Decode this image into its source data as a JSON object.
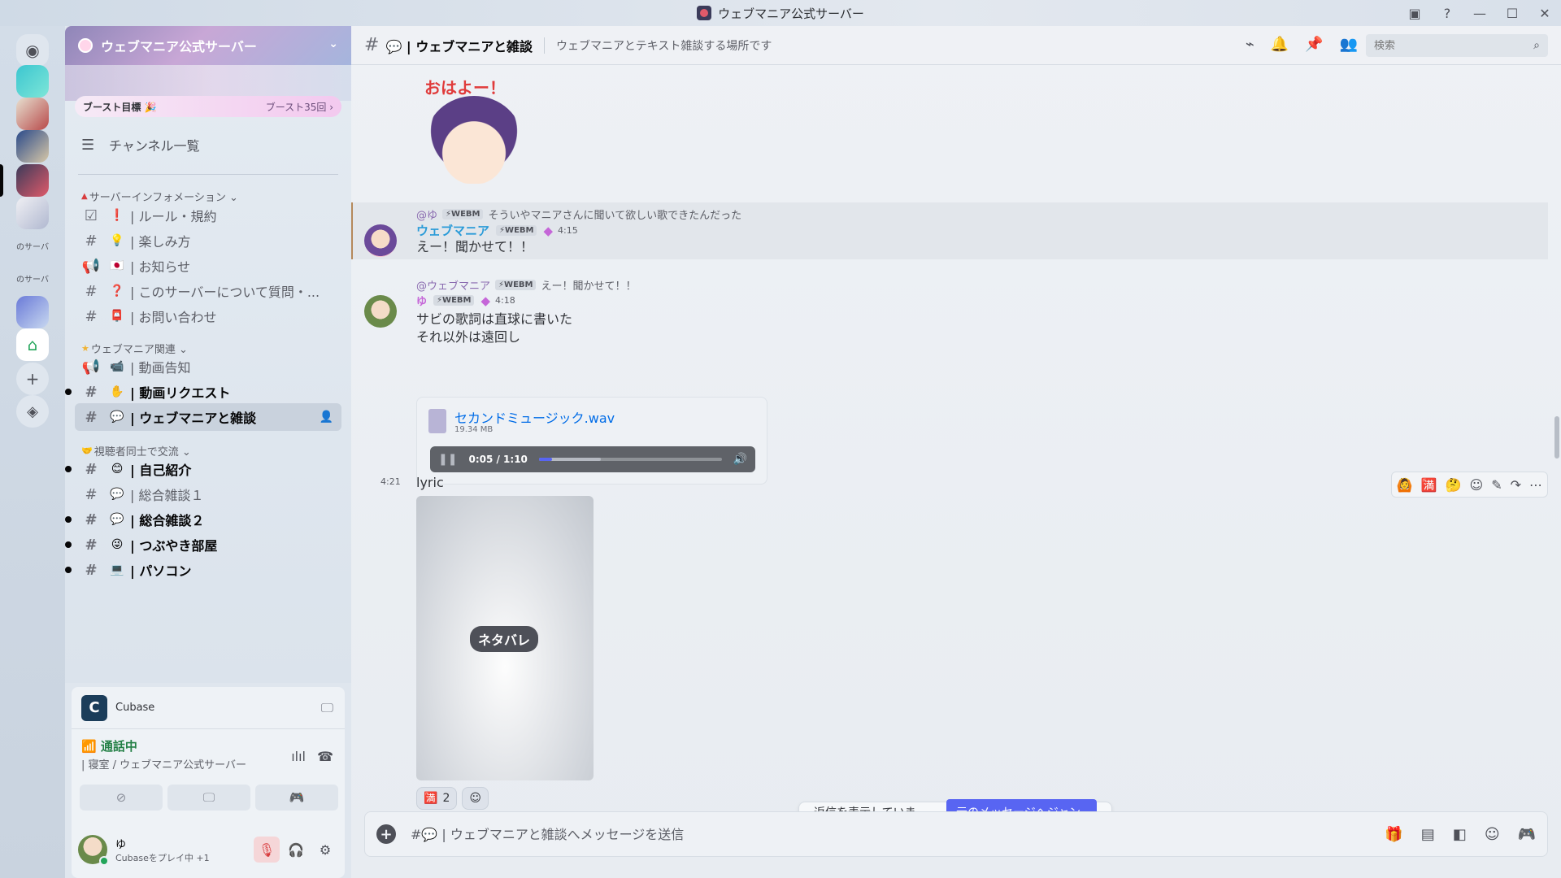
{
  "window": {
    "title": "ウェブマニア公式サーバー"
  },
  "rail": {
    "labels": [
      "のサーバ",
      "のサーバ"
    ]
  },
  "guild": {
    "name": "ウェブマニア公式サーバー",
    "boost_goal": "ブースト目標 🎉",
    "boost_count": "ブースト35回 ›",
    "channel_browser": "チャンネル一覧"
  },
  "categories": [
    {
      "label": "サーバーインフォメーション ⌄"
    },
    {
      "label": "ウェブマニア関連 ⌄"
    },
    {
      "label": "視聴者同士で交流 ⌄"
    }
  ],
  "channels": [
    {
      "emoji": "❗",
      "label": "| ルール・規約"
    },
    {
      "emoji": "💡",
      "label": "| 楽しみ方"
    },
    {
      "emoji": "🇯🇵",
      "label": "| お知らせ"
    },
    {
      "emoji": "❓",
      "label": "| このサーバーについて質問・..."
    },
    {
      "emoji": "📮",
      "label": "| お問い合わせ"
    },
    {
      "emoji": "📹",
      "label": "| 動画告知"
    },
    {
      "emoji": "✋",
      "label": "| 動画リクエスト"
    },
    {
      "emoji": "💬",
      "label": "| ウェブマニアと雑談"
    },
    {
      "emoji": "😊",
      "label": "| 自己紹介"
    },
    {
      "emoji": "💬",
      "label": "| 総合雑談１"
    },
    {
      "emoji": "💬",
      "label": "| 総合雑談２"
    },
    {
      "emoji": "😜",
      "label": "| つぶやき部屋"
    },
    {
      "emoji": "💻",
      "label": "| パソコン"
    }
  ],
  "activity": {
    "app": "Cubase"
  },
  "voice": {
    "status": "通話中",
    "channel": "| 寝室 / ウェブマニア公式サーバー"
  },
  "user": {
    "name": "ゆ",
    "status": "Cubaseをプレイ中 +1"
  },
  "topbar": {
    "channel": "💬 | ウェブマニアと雑談",
    "topic": "ウェブマニアとテキスト雑談する場所です",
    "search_placeholder": "検索"
  },
  "chat": {
    "sticker_text": "おはよー！",
    "msg1": {
      "reply_author": "@ゆ",
      "reply_tag": "⚡WEBM",
      "reply_text": "そういやマニアさんに聞いて欲しい歌できたんだった",
      "author": "ウェブマニア",
      "tag": "⚡WEBM",
      "time": "4:15",
      "text": "えー！聞かせて！！"
    },
    "msg2": {
      "reply_author": "@ウェブマニア",
      "reply_tag": "⚡WEBM",
      "reply_text": "えー！聞かせて！！",
      "author": "ゆ",
      "tag": "⚡WEBM",
      "time": "4:18",
      "line1": "サビの歌詞は直球に書いた",
      "line2": "それ以外は遠回し",
      "file_name": "セカンドミュージック.wav",
      "file_size": "19.34 MB",
      "audio_time": "0:05 / 1:10",
      "audio_progress": 0.071,
      "audio_buffered": 0.34
    },
    "msg3": {
      "time": "4:21",
      "text": "lyric",
      "spoiler": "ネタバレ",
      "reaction_count": "2"
    },
    "jump": {
      "text": "返信を表示しています。",
      "button": "元のメッセージへジャンプ"
    }
  },
  "composer": {
    "placeholder": "#💬 | ウェブマニアと雑談へメッセージを送信"
  },
  "colors": {
    "accent": "#5865f2",
    "author_webmania": "#2a9bd8",
    "online": "#23a55a"
  }
}
